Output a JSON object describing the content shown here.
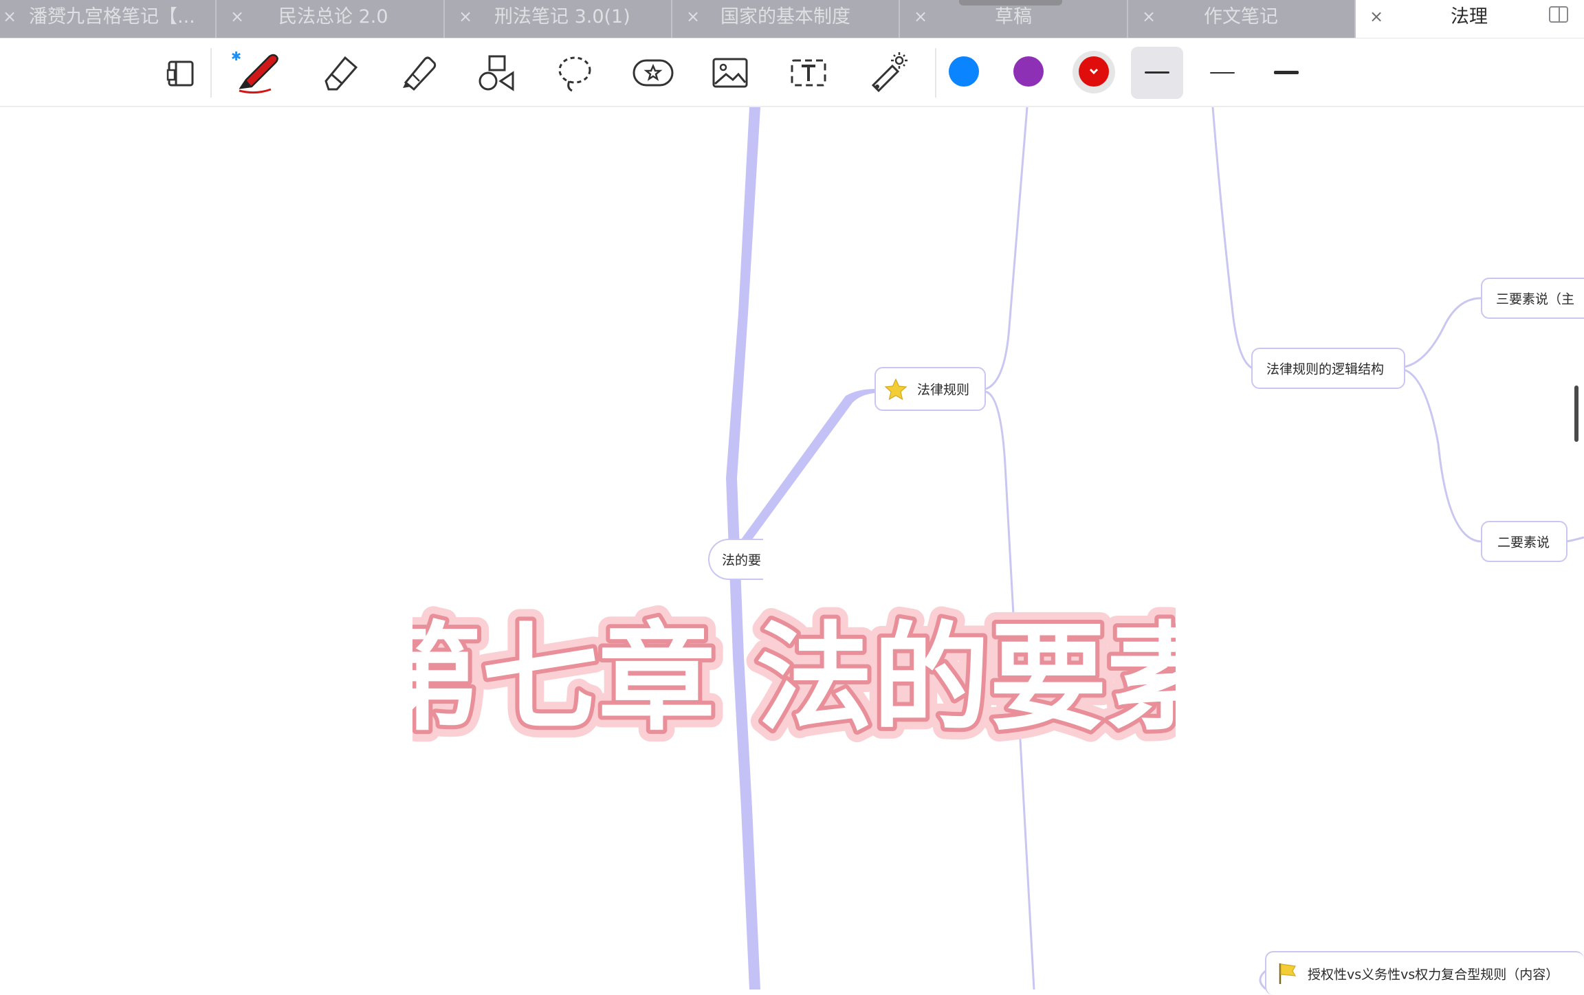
{
  "tabs": [
    {
      "label": "潘赟九宫格笔记【...",
      "close": "×",
      "active": false
    },
    {
      "label": "民法总论 2.0",
      "close": "×",
      "active": false
    },
    {
      "label": "刑法笔记 3.0(1)",
      "close": "×",
      "active": false
    },
    {
      "label": "国家的基本制度",
      "close": "×",
      "active": false
    },
    {
      "label": "草稿",
      "close": "×",
      "active": false
    },
    {
      "label": "作文笔记",
      "close": "×",
      "active": false
    },
    {
      "label": "法理",
      "close": "×",
      "active": true
    }
  ],
  "toolbar": {
    "tools": [
      "page-view",
      "pen",
      "eraser",
      "highlighter",
      "shapes",
      "lasso",
      "sticker",
      "image",
      "text",
      "laser-pointer"
    ],
    "colors": [
      "#0a84ff",
      "#8e30b5",
      "#e00d0d"
    ],
    "selected_color": "#e00d0d",
    "stroke_widths": [
      "medium",
      "thin",
      "thick"
    ],
    "selected_stroke": "medium"
  },
  "mindmap": {
    "central_partial": "法的要",
    "rule_node": "法律规则",
    "logic_node": "法律规则的逻辑结构",
    "three_elements": "三要素说（主",
    "two_elements": "二要素说",
    "bottom_node": "授权性vs义务性vs权力复合型规则（内容）"
  },
  "overlay_title": "第七章 法的要素",
  "colors": {
    "branch_main": "#c3c1f6",
    "branch_thin": "#c9c6f2",
    "title_fill": "#ffffff",
    "title_stroke": "#e98f9a",
    "title_glow": "#fbd0d5",
    "sparkle": "#6fb7ec"
  }
}
